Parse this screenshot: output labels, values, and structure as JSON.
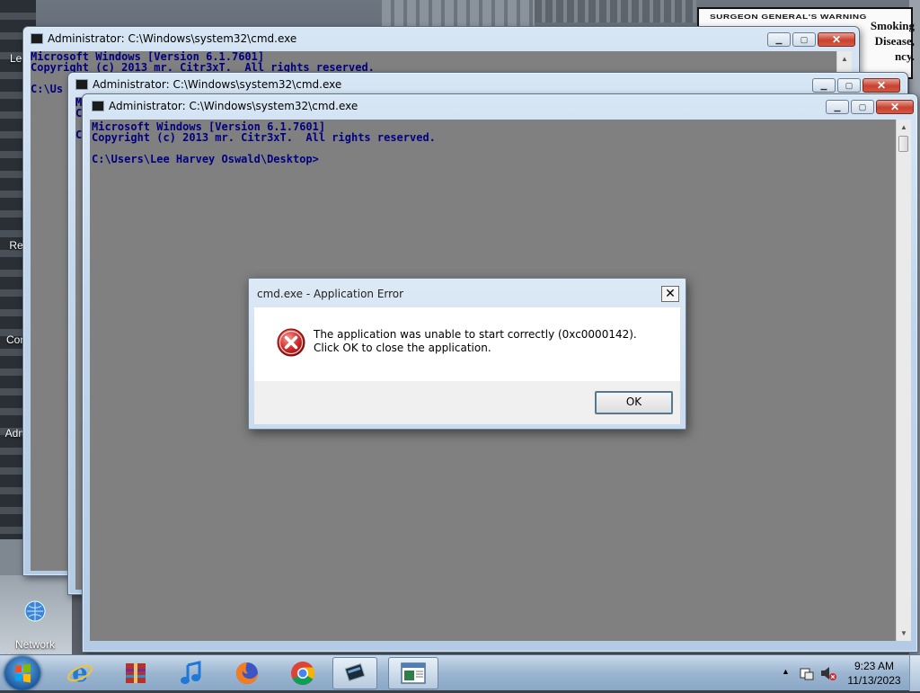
{
  "desktop": {
    "sign_text": [
      "Smoking",
      "Disease,",
      "ncy."
    ],
    "sign_header": "SURGEON GENERAL'S WARNING",
    "icons": [
      {
        "label": "Lee",
        "icon": "folder-icon"
      },
      {
        "label": "Rec",
        "icon": "recycle-bin-icon"
      },
      {
        "label": "Con",
        "icon": "control-panel-icon"
      },
      {
        "label": "Adm",
        "icon": "admin-tools-icon"
      },
      {
        "label": "Network\nConnections",
        "icon": "network-icon"
      }
    ]
  },
  "windows": [
    {
      "title": "Administrator: C:\\Windows\\system32\\cmd.exe",
      "console": "Microsoft Windows [Version 6.1.7601]\nCopyright (c) 2013 mr. Citr3xT.  All rights reserved.\n\nC:\\Us"
    },
    {
      "title": "Administrator: C:\\Windows\\system32\\cmd.exe",
      "console": "M\nC\n\nC"
    },
    {
      "title": "Administrator: C:\\Windows\\system32\\cmd.exe",
      "console": "Microsoft Windows [Version 6.1.7601]\nCopyright (c) 2013 mr. Citr3xT.  All rights reserved.\n\nC:\\Users\\Lee Harvey Oswald\\Desktop>"
    }
  ],
  "dialog": {
    "title": "cmd.exe - Application Error",
    "message": "The application was unable to start correctly (0xc0000142). Click OK to close the application.",
    "ok_label": "OK",
    "close_glyph": "✕"
  },
  "taskbar": {
    "pinned": [
      {
        "name": "internet-explorer-icon",
        "glyph": "e"
      },
      {
        "name": "archive-icon",
        "glyph": "▦"
      },
      {
        "name": "music-player-icon",
        "glyph": "♫"
      },
      {
        "name": "firefox-icon",
        "glyph": "◉"
      },
      {
        "name": "chrome-icon",
        "glyph": "◎"
      },
      {
        "name": "cmd-taskbar-icon",
        "glyph": "▣"
      },
      {
        "name": "window-taskbar-icon",
        "glyph": "▤"
      }
    ],
    "time": "9:23 AM",
    "date": "11/13/2023"
  },
  "colors": {
    "console_bg": "#808080",
    "console_text": "#000080",
    "close_red": "#c8412e",
    "error_red": "#d32a2a"
  }
}
